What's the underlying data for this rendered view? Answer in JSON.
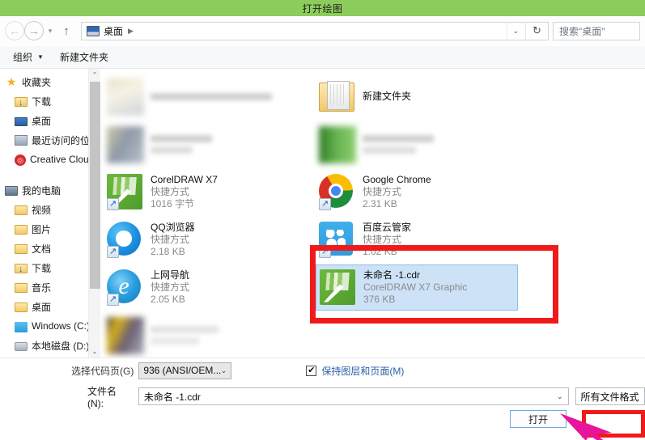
{
  "window": {
    "title": "打开绘图"
  },
  "nav": {
    "back_icon": "back-arrow-icon",
    "forward_icon": "forward-arrow-icon",
    "history_icon": "chevron-down-icon",
    "up_icon": "up-arrow-icon",
    "breadcrumb": "桌面",
    "breadcrumb_sep": "▶",
    "address_caret": "⌄",
    "refresh_icon": "↻",
    "search_placeholder": "搜索\"桌面\""
  },
  "commandbar": {
    "organize": "组织",
    "organize_caret": "▼",
    "new_folder": "新建文件夹"
  },
  "sidebar": {
    "groups": [
      {
        "header": "收藏夹",
        "items": [
          {
            "label": "下载",
            "icon": "download-folder-icon"
          },
          {
            "label": "桌面",
            "icon": "desktop-monitor-icon"
          },
          {
            "label": "最近访问的位置",
            "icon": "recent-places-icon"
          },
          {
            "label": "Creative Cloud",
            "icon": "creative-cloud-icon"
          }
        ]
      },
      {
        "header": "我的电脑",
        "items": [
          {
            "label": "视频",
            "icon": "videos-folder-icon"
          },
          {
            "label": "图片",
            "icon": "pictures-folder-icon"
          },
          {
            "label": "文档",
            "icon": "documents-folder-icon"
          },
          {
            "label": "下载",
            "icon": "download-folder-icon"
          },
          {
            "label": "音乐",
            "icon": "music-folder-icon"
          },
          {
            "label": "桌面",
            "icon": "desktop-folder-icon"
          },
          {
            "label": "Windows (C:)",
            "icon": "windows-drive-icon"
          },
          {
            "label": "本地磁盘 (D:)",
            "icon": "local-drive-icon"
          }
        ]
      }
    ],
    "scroll_up": "⌃",
    "scroll_down": "⌄"
  },
  "files": {
    "column1": [
      {
        "blurred": true,
        "name": "",
        "type": "",
        "size": "",
        "icon": "blurred-file-icon"
      },
      {
        "blurred": true,
        "name": "",
        "type": "",
        "size": "",
        "icon": "blurred-file-icon"
      },
      {
        "blurred": false,
        "name": "CorelDRAW X7",
        "type": "快捷方式",
        "size": "1016 字节",
        "icon": "coreldraw-icon"
      },
      {
        "blurred": false,
        "name": "QQ浏览器",
        "type": "快捷方式",
        "size": "2.18 KB",
        "icon": "qq-browser-icon"
      },
      {
        "blurred": false,
        "name": "上网导航",
        "type": "快捷方式",
        "size": "2.05 KB",
        "icon": "internet-explorer-icon"
      },
      {
        "blurred": true,
        "name": "",
        "type": "",
        "size": "",
        "icon": "blurred-file-icon"
      }
    ],
    "column2": [
      {
        "blurred": false,
        "name": "新建文件夹",
        "type": "",
        "size": "",
        "icon": "folder-icon"
      },
      {
        "blurred": true,
        "name": "",
        "type": "",
        "size": "",
        "icon": "blurred-file-icon"
      },
      {
        "blurred": false,
        "name": "Google Chrome",
        "type": "快捷方式",
        "size": "2.31 KB",
        "icon": "chrome-icon"
      },
      {
        "blurred": false,
        "name": "百度云管家",
        "type": "快捷方式",
        "size": "1.02 KB",
        "icon": "baidu-cloud-icon"
      },
      {
        "blurred": false,
        "selected": true,
        "name": "未命名 -1.cdr",
        "type": "CorelDRAW X7 Graphic",
        "size": "376 KB",
        "icon": "coreldraw-document-icon"
      }
    ]
  },
  "bottom": {
    "codepage_label": "选择代码页(G)",
    "codepage_value": "936  (ANSI/OEM...",
    "codepage_caret": "⌄",
    "keep_layers_label": "保持图层和页面(M)",
    "keep_layers_checked": "✔",
    "filename_label": "文件名(N):",
    "filename_value": "未命名 -1.cdr",
    "filename_caret": "⌄",
    "filetype_value": "所有文件格式",
    "filetype_caret": "⌄",
    "open_button": "打开"
  },
  "annotations": {
    "highlight_color": "#f01a1a",
    "cursor_color": "#e8159c"
  }
}
